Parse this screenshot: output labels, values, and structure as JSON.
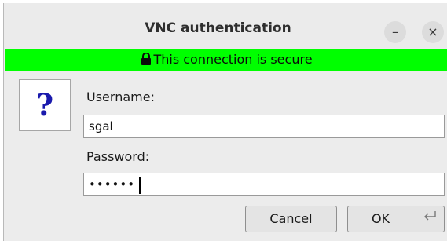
{
  "window": {
    "title": "VNC authentication",
    "minimize_symbol": "–",
    "close_symbol": "×"
  },
  "banner": {
    "text": "This connection is secure",
    "color": "#00ff00",
    "icon": "lock-icon"
  },
  "dialog_icon": {
    "symbol": "?",
    "name": "question-icon"
  },
  "form": {
    "username_label": "Username:",
    "username_value": "sgal",
    "password_label": "Password:",
    "password_value": "••••••"
  },
  "buttons": {
    "cancel_label": "Cancel",
    "ok_label": "OK",
    "ok_icon": "enter-key-icon"
  }
}
